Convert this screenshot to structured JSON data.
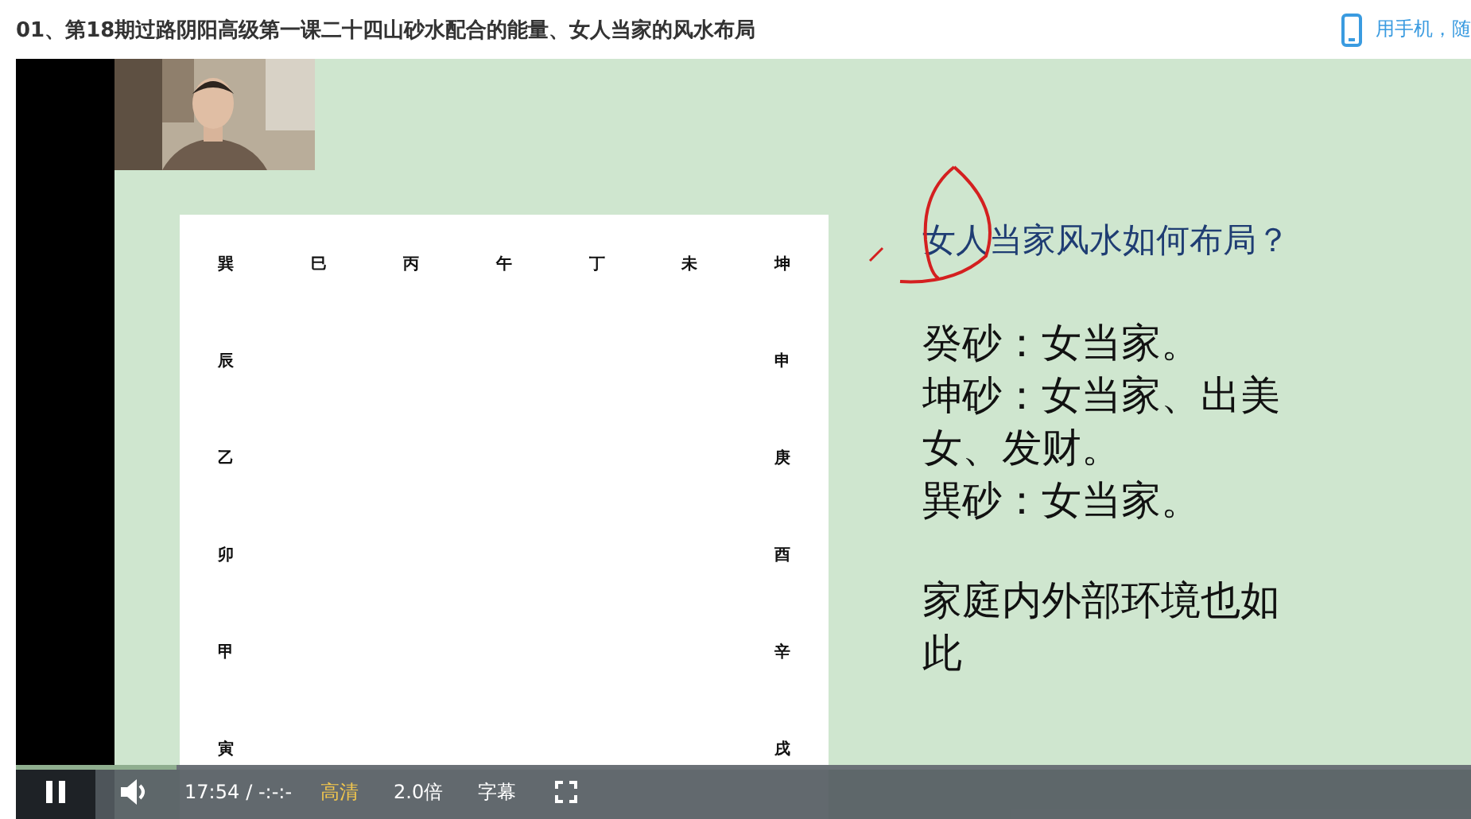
{
  "title": "01、第18期过路阴阳高级第一课二十四山砂水配合的能量、女人当家的风水布局",
  "mobile_link": "用手机，随",
  "slide": {
    "compass": {
      "top_row": [
        "巽",
        "巳",
        "丙",
        "午",
        "丁",
        "未",
        "坤"
      ],
      "left_column": [
        "辰",
        "乙",
        "卯",
        "甲",
        "寅"
      ],
      "right_column": [
        "申",
        "庚",
        "酉",
        "辛",
        "戌"
      ]
    },
    "heading": "女人当家风水如何布局？",
    "lines": [
      "癸砂：女当家。",
      "坤砂：女当家、出美女、发财。",
      "巽砂：女当家。"
    ],
    "closing": "家庭内外部环境也如此"
  },
  "player": {
    "playing": true,
    "level": 0.11,
    "time": "17:54",
    "duration": "/ -:-:-",
    "quality": "高清",
    "speed": "2.0倍",
    "subtitles": "字幕"
  }
}
